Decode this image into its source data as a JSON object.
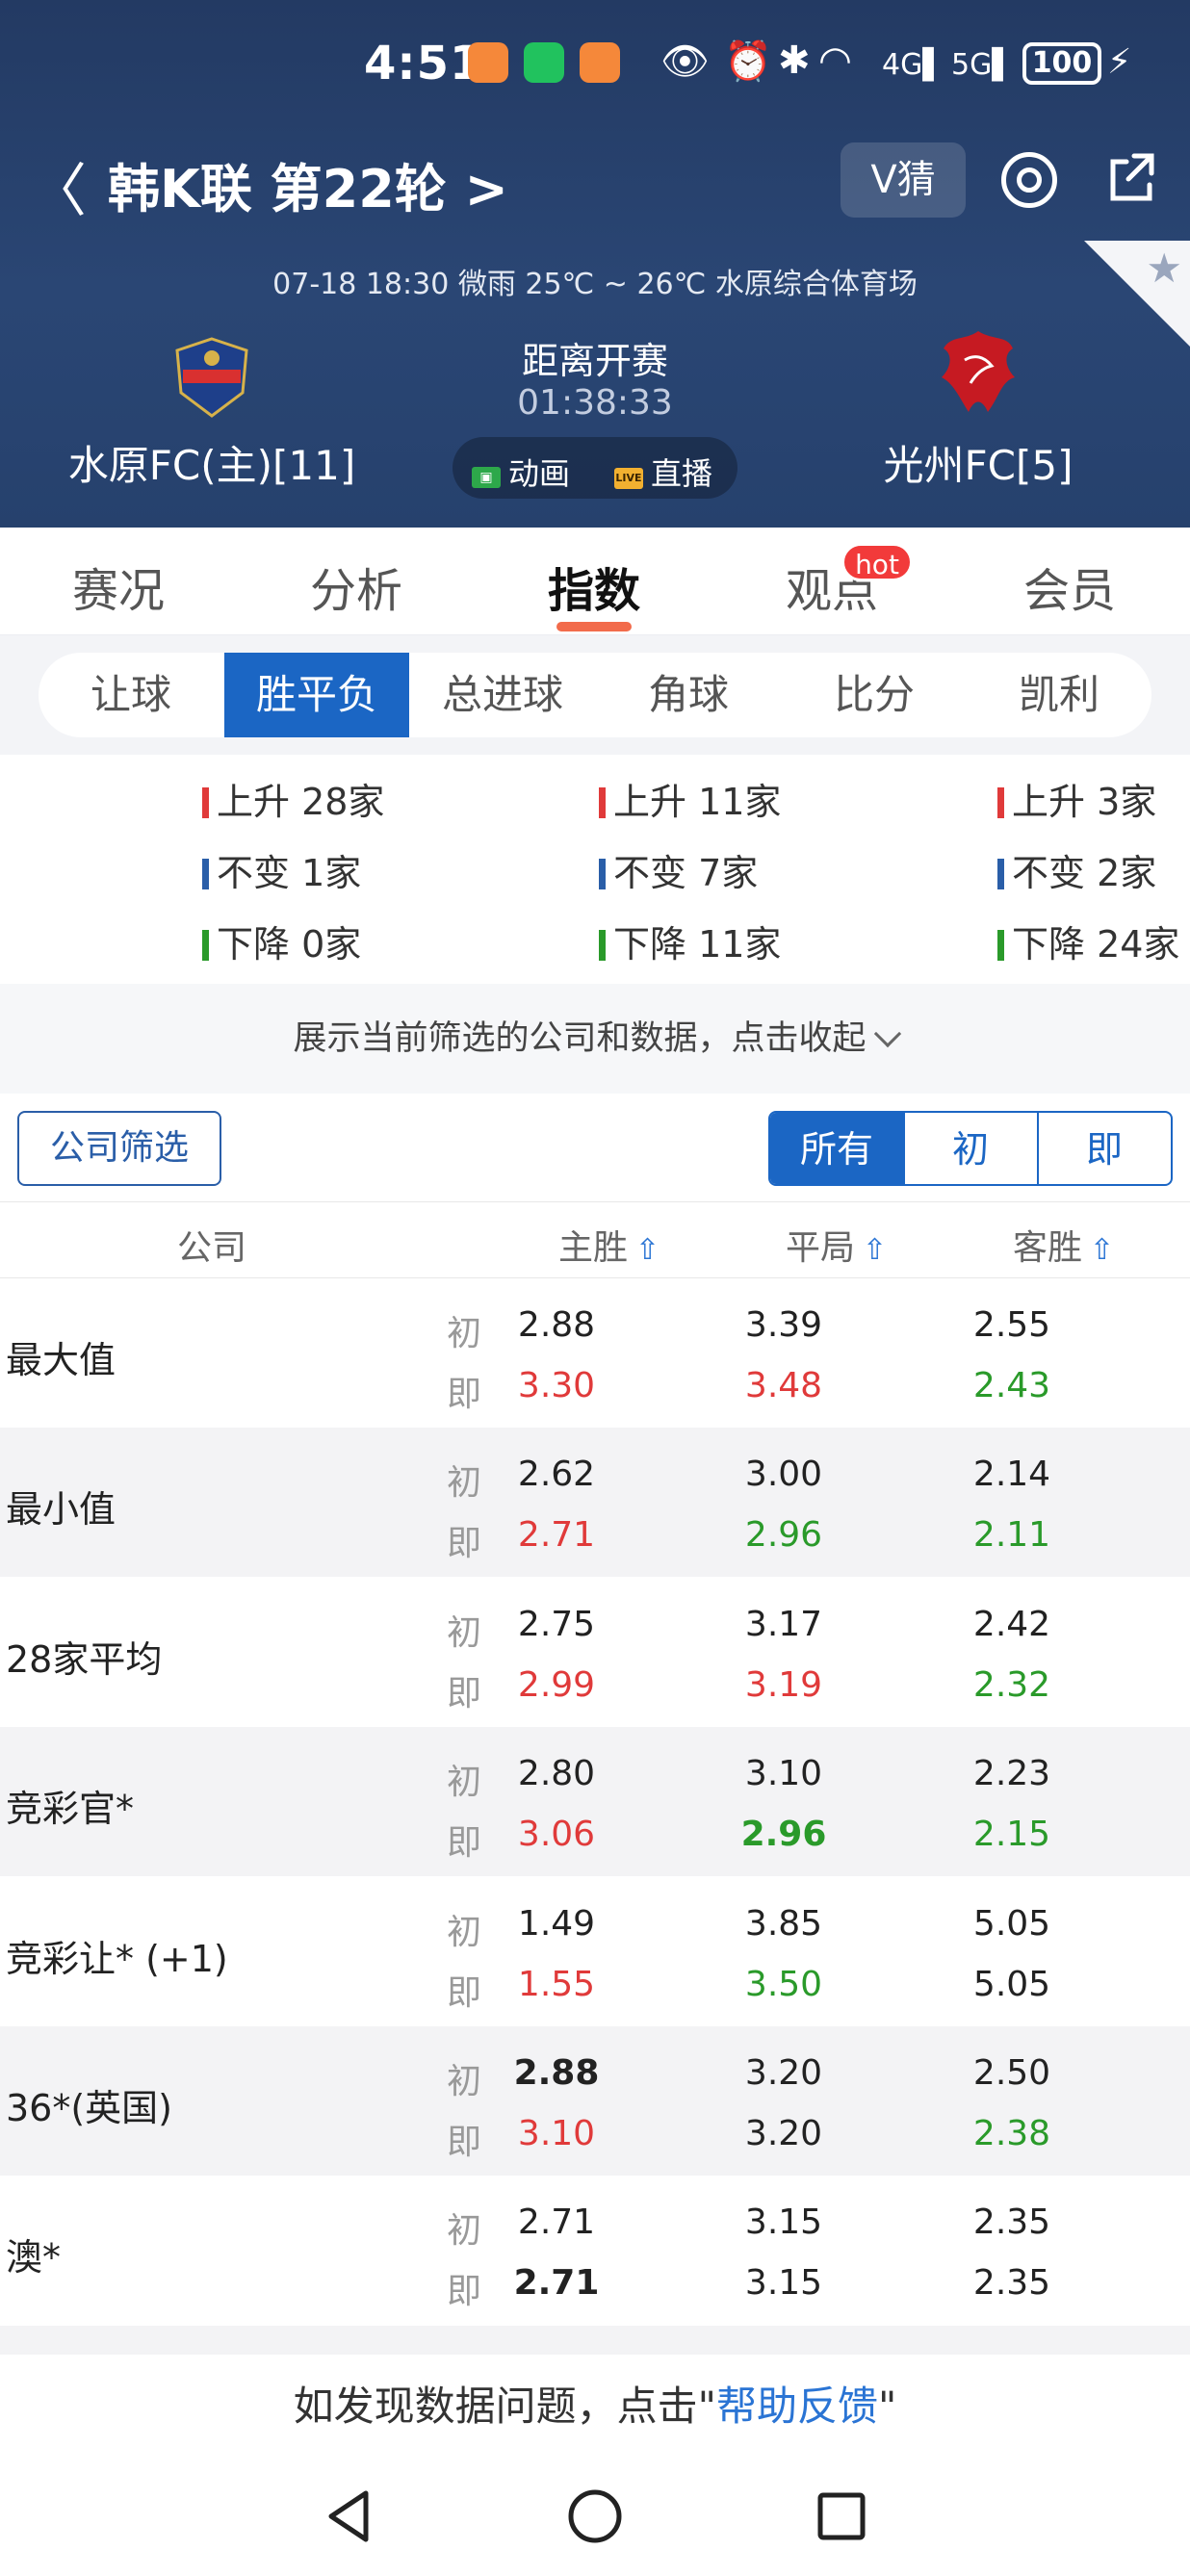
{
  "status_bar": {
    "time": "4:51",
    "battery": "100"
  },
  "header": {
    "league_title": "韩K联 第22轮 >",
    "vguess_label": "V猜",
    "match_info": "07-18 18:30   微雨 25℃ ~ 26℃   水原综合体育场",
    "home_team": "水原FC(主)[11]",
    "away_team": "光州FC[5]",
    "kickoff_label": "距离开赛",
    "countdown": "01:38:33",
    "animation_label": "动画",
    "live_label": "直播",
    "live_icon_text": "LIVE",
    "colors": {
      "header_bg": "#233a63",
      "accent": "#1b66c4",
      "tab_underline": "#f26b4b"
    }
  },
  "main_tabs": [
    {
      "label": "赛况"
    },
    {
      "label": "分析"
    },
    {
      "label": "指数",
      "active": true
    },
    {
      "label": "观点",
      "badge": "hot"
    },
    {
      "label": "会员"
    }
  ],
  "sub_tabs": [
    {
      "label": "让球"
    },
    {
      "label": "胜平负",
      "active": true
    },
    {
      "label": "总进球"
    },
    {
      "label": "角球"
    },
    {
      "label": "比分"
    },
    {
      "label": "凯利"
    }
  ],
  "trend_stats": [
    {
      "up": "上升 28家",
      "same": "不变 1家",
      "down": "下降 0家"
    },
    {
      "up": "上升 11家",
      "same": "不变 7家",
      "down": "下降 11家"
    },
    {
      "up": "上升 3家",
      "same": "不变 2家",
      "down": "下降 24家"
    }
  ],
  "notice": "展示当前筛选的公司和数据，点击收起",
  "filter": {
    "company_filter_label": "公司筛选",
    "segments": [
      "所有",
      "初",
      "即"
    ],
    "active_segment": "所有"
  },
  "table": {
    "headers": {
      "company": "公司",
      "home_win": "主胜",
      "draw": "平局",
      "away_win": "客胜"
    },
    "row_labels": {
      "initial": "初",
      "live": "即"
    },
    "rows": [
      {
        "company": "最大值",
        "initial": [
          "2.88",
          "3.39",
          "2.55"
        ],
        "live": [
          "3.30",
          "3.48",
          "2.43"
        ],
        "live_trend": [
          "up",
          "up",
          "down"
        ]
      },
      {
        "company": "最小值",
        "initial": [
          "2.62",
          "3.00",
          "2.14"
        ],
        "live": [
          "2.71",
          "2.96",
          "2.11"
        ],
        "live_trend": [
          "up",
          "down",
          "down"
        ]
      },
      {
        "company": "28家平均",
        "initial": [
          "2.75",
          "3.17",
          "2.42"
        ],
        "live": [
          "2.99",
          "3.19",
          "2.32"
        ],
        "live_trend": [
          "up",
          "up",
          "down"
        ]
      },
      {
        "company": "竞彩官*",
        "initial": [
          "2.80",
          "3.10",
          "2.23"
        ],
        "live": [
          "3.06",
          "2.96",
          "2.15"
        ],
        "live_trend": [
          "up",
          "down-bold",
          "down"
        ]
      },
      {
        "company": "竞彩让* (+1)",
        "initial": [
          "1.49",
          "3.85",
          "5.05"
        ],
        "live": [
          "1.55",
          "3.50",
          "5.05"
        ],
        "live_trend": [
          "up",
          "down",
          "same"
        ]
      },
      {
        "company": "36*(英国)",
        "initial": [
          "2.88",
          "3.20",
          "2.50"
        ],
        "live": [
          "3.10",
          "3.20",
          "2.38"
        ],
        "initial_bold": [
          true,
          false,
          false
        ],
        "live_trend": [
          "up",
          "same",
          "down"
        ]
      },
      {
        "company": "澳*",
        "initial": [
          "2.71",
          "3.15",
          "2.35"
        ],
        "live": [
          "2.71",
          "3.15",
          "2.35"
        ],
        "live_bold": [
          true,
          false,
          false
        ],
        "live_trend": [
          "same",
          "same",
          "same"
        ]
      }
    ]
  },
  "footer": {
    "feedback_prefix": "如发现数据问题，点击\"",
    "feedback_link": "帮助反馈",
    "feedback_suffix": "\""
  }
}
